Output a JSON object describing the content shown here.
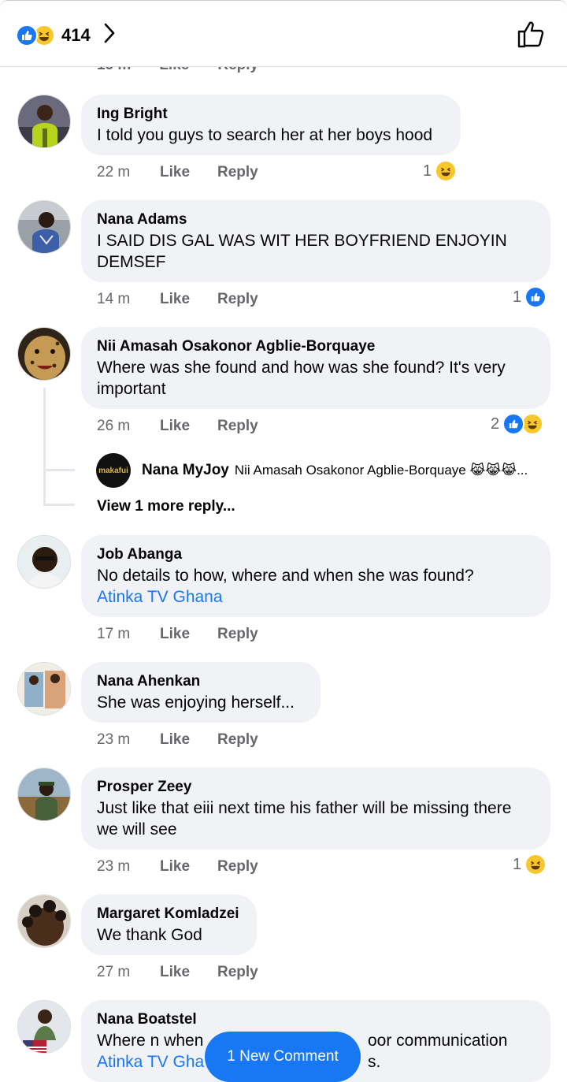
{
  "header": {
    "reaction_count": "414",
    "icons": [
      "like-reaction-icon",
      "haha-reaction-icon",
      "chevron-right-icon",
      "thumbs-up-outline-icon"
    ]
  },
  "actions": {
    "like": "Like",
    "reply": "Reply"
  },
  "cut_row": {
    "time": "15 m"
  },
  "comments": [
    {
      "author": "Ing Bright",
      "text": "I told you guys to search her at her boys hood",
      "time": "22 m",
      "reaction_count": "1"
    },
    {
      "author": "Nana Adams",
      "text": "I SAID DIS GAL WAS WIT HER BOYFRIEND ENJOYIN DEMSEF",
      "time": "14 m",
      "reaction_count": "1"
    },
    {
      "author": "Nii Amasah Osakonor Agblie-Borquaye",
      "text": "Where was she found and how was she found? It's very important",
      "time": "26 m",
      "reaction_count": "2"
    },
    {
      "author": "Job Abanga",
      "text": "No details to how, where and when she was found?",
      "mention": "Atinka TV Ghana",
      "time": "17 m"
    },
    {
      "author": "Nana Ahenkan",
      "text": "She was enjoying herself...",
      "time": "23 m"
    },
    {
      "author": "Prosper Zeey",
      "text": "Just like that eiii next time his father will be missing there we will see",
      "time": "23 m",
      "reaction_count": "1"
    },
    {
      "author": "Margaret Komladzei",
      "text": "We thank God",
      "time": "27 m"
    },
    {
      "author": "Nana Boatstel",
      "text_start": "Where n when",
      "text_end": "oor communication",
      "mention": "Atinka TV Gha",
      "mention_tail": "s."
    }
  ],
  "reply": {
    "avatar_text": "makafui",
    "author": "Nana MyJoy",
    "text": "Nii Amasah Osakonor Agblie-Borquaye 😹😹😹...",
    "view_more": "View 1 more reply..."
  },
  "new_comment_button": "1 New Comment",
  "colors": {
    "accent": "#1877f2",
    "bubble": "#f0f2f5",
    "meta": "#65676b",
    "haha": "#f7c72c"
  }
}
